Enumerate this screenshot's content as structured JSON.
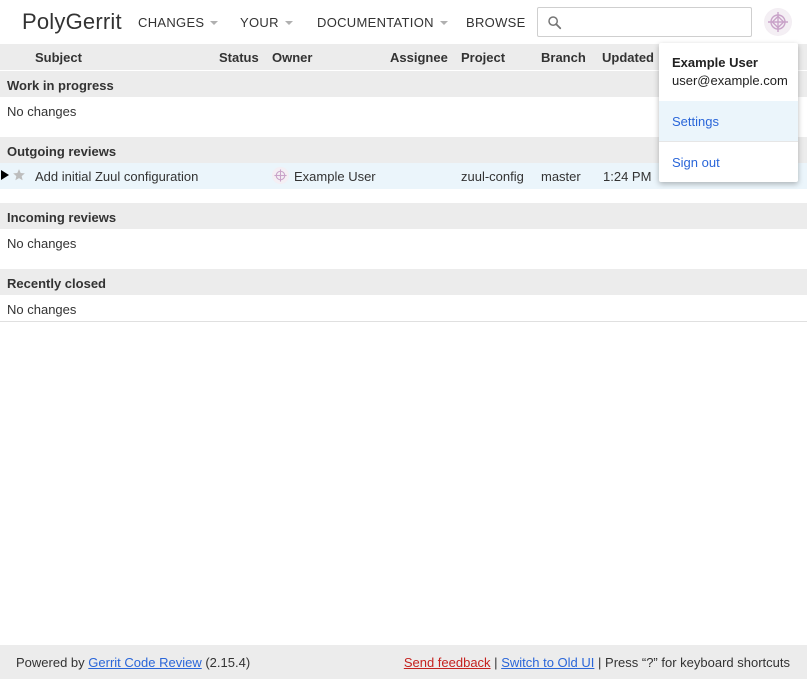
{
  "header": {
    "logo": "PolyGerrit",
    "nav": [
      {
        "label": "CHANGES"
      },
      {
        "label": "YOUR"
      },
      {
        "label": "DOCUMENTATION"
      },
      {
        "label": "BROWSE"
      }
    ],
    "search": {
      "value": "",
      "placeholder": "",
      "icon": "search-icon"
    },
    "avatar_icon": "avatar-icon"
  },
  "columns": [
    "Subject",
    "Status",
    "Owner",
    "Assignee",
    "Project",
    "Branch",
    "Updated"
  ],
  "sections": [
    {
      "title": "Work in progress",
      "empty_text": "No changes"
    },
    {
      "title": "Outgoing reviews"
    },
    {
      "title": "Incoming reviews",
      "empty_text": "No changes"
    },
    {
      "title": "Recently closed",
      "empty_text": "No changes"
    }
  ],
  "outgoing_change": {
    "subject": "Add initial Zuul configuration",
    "status": "",
    "owner": "Example User",
    "assignee": "",
    "project": "zuul-config",
    "branch": "master",
    "updated": "1:24 PM"
  },
  "account_dropdown": {
    "name": "Example User",
    "email": "user@example.com",
    "settings": "Settings",
    "sign_out": "Sign out"
  },
  "footer": {
    "powered_by": "Powered by",
    "gerrit_link": "Gerrit Code Review",
    "version": "(2.15.4)",
    "send_feedback": "Send feedback",
    "sep": "|",
    "switch_old_ui": "Switch to Old UI",
    "shortcut_text": "Press “?” for keyboard shortcuts"
  },
  "colors": {
    "accent": "#2a66d9",
    "feedback": "#c5221f",
    "header_bg": "#ececec",
    "selected_row": "#ebf5fb"
  }
}
